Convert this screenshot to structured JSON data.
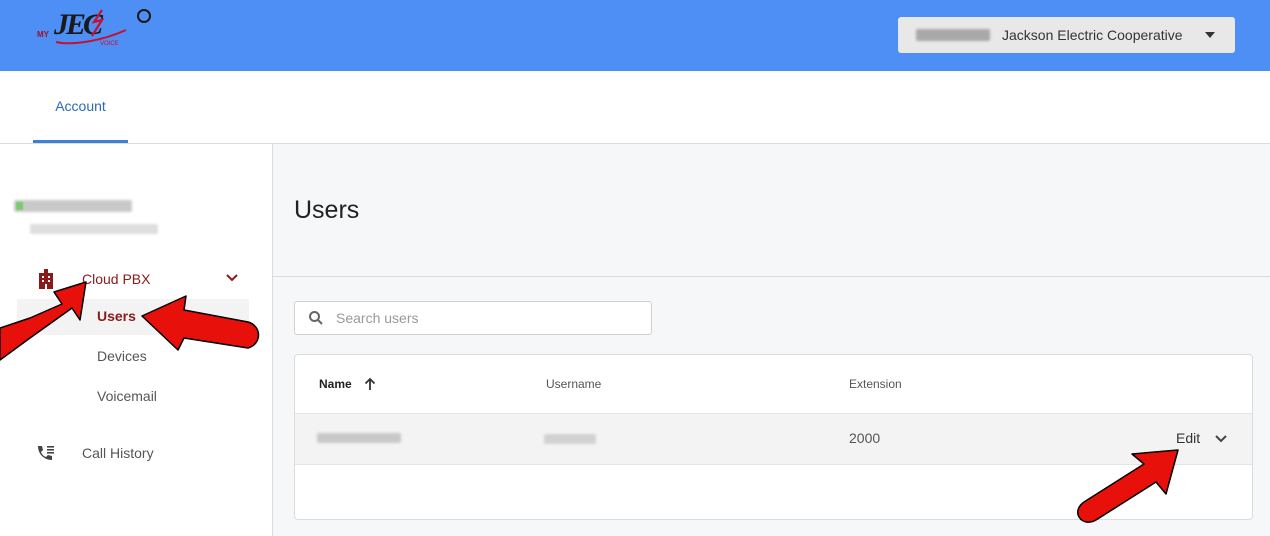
{
  "header": {
    "logo_text": "JEC",
    "logo_prefix": "MY",
    "logo_suffix": "VOICE",
    "account_name": "Jackson Electric Cooperative",
    "bg_color": "#4d8ff5"
  },
  "tabs": [
    {
      "label": "Account",
      "active": true
    }
  ],
  "sidebar": {
    "cloud_pbx": {
      "label": "Cloud PBX",
      "icon": "building-icon",
      "expanded": true
    },
    "items": [
      {
        "label": "Users",
        "active": true
      },
      {
        "label": "Devices",
        "active": false
      },
      {
        "label": "Voicemail",
        "active": false
      }
    ],
    "call_history": {
      "label": "Call History",
      "icon": "phone-list-icon"
    }
  },
  "main": {
    "title": "Users",
    "search": {
      "placeholder": "Search users",
      "value": ""
    },
    "table": {
      "columns": {
        "name": "Name",
        "username": "Username",
        "extension": "Extension"
      },
      "sort": {
        "column": "name",
        "direction": "asc"
      },
      "rows": [
        {
          "extension": "2000",
          "action": "Edit"
        }
      ]
    }
  },
  "colors": {
    "accent": "#3d7fd4",
    "active_nav": "#8b1a1a",
    "annotation_arrow": "#e8100a"
  }
}
